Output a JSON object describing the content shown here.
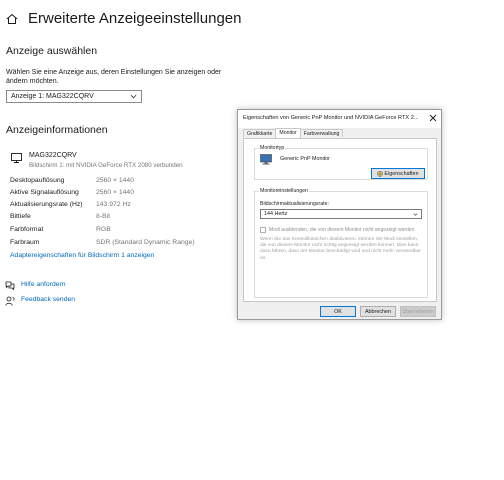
{
  "header": {
    "title": "Erweiterte Anzeigeeinstellungen"
  },
  "select_display": {
    "heading": "Anzeige auswählen",
    "description": "Wählen Sie eine Anzeige aus, deren Einstellungen Sie anzeigen oder ändern möchten.",
    "selected": "Anzeige 1: MAG322CQRV"
  },
  "display_info": {
    "heading": "Anzeigeinformationen",
    "monitor_name": "MAG322CQRV",
    "monitor_sub": "Bildschirm 1: mit NVIDIA GeForce RTX 2080 verbunden",
    "rows": [
      {
        "label": "Desktopauflösung",
        "value": "2560 × 1440"
      },
      {
        "label": "Aktive Signalauflösung",
        "value": "2560 × 1440"
      },
      {
        "label": "Aktualisierungsrate (Hz)",
        "value": "143.972 Hz"
      },
      {
        "label": "Bittiefe",
        "value": "8-Bit"
      },
      {
        "label": "Farbformat",
        "value": "RGB"
      },
      {
        "label": "Farbraum",
        "value": "SDR (Standard Dynamic Range)"
      }
    ],
    "adapter_link": "Adaptereigenschaften für Bildschirm 1 anzeigen"
  },
  "help": {
    "help_link": "Hilfe anfordern",
    "feedback_link": "Feedback senden"
  },
  "dialog": {
    "title": "Eigenschaften von Generic PnP Monitor und NVIDIA GeForce RTX 2...",
    "tabs": [
      "Grafikkarte",
      "Monitor",
      "Farbverwaltung"
    ],
    "active_tab": "Monitor",
    "monitor_type_group": "Monitortyp",
    "monitor_type_name": "Generic PnP Monitor",
    "properties_button": "Eigenschaften",
    "monitor_settings_group": "Monitoreinstellungen",
    "refresh_label": "Bildschirmaktualisierungsrate:",
    "refresh_value": "144 Hertz",
    "hide_modes_label": "Modi ausblenden, die von diesem Monitor nicht angezeigt werden",
    "hide_modes_checked": false,
    "warning_text": "Wenn Sie das Kontrollkästchen deaktivieren, können Sie Modi einstellen, die von diesem Monitor nicht richtig angezeigt werden können. Dies kann dazu führen, dass der Monitor beschädigt wird und nicht mehr verwendbar ist.",
    "ok_button": "OK",
    "cancel_button": "Abbrechen",
    "apply_button": "Übernehmen"
  },
  "colors": {
    "link": "#0067c0",
    "secondary_text": "#767676"
  }
}
